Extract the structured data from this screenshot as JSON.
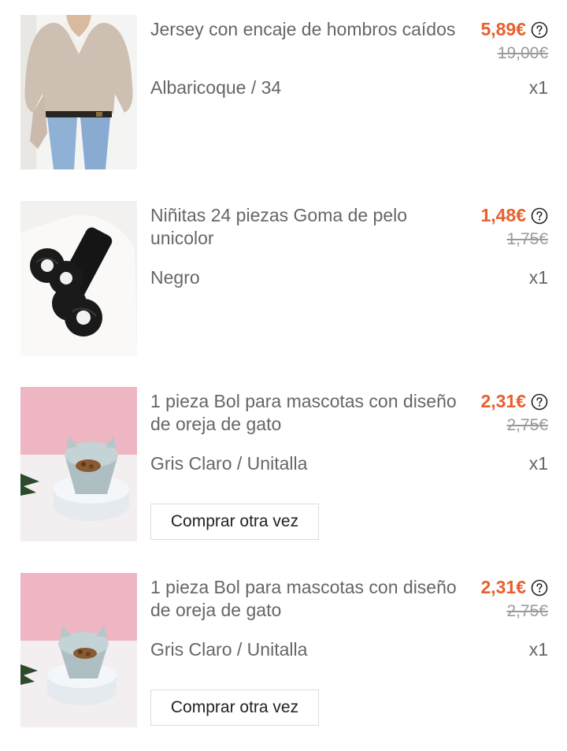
{
  "items": [
    {
      "title": "Jersey con encaje de hombros caídos",
      "price": "5,89€",
      "original_price": "19,00€",
      "variant": "Albaricoque / 34",
      "quantity": "x1",
      "price_help_icon": "question-circle-icon",
      "image": "beige-lace-sweater-jeans"
    },
    {
      "title": "Niñitas 24 piezas Goma de pelo unicolor",
      "price": "1,48€",
      "original_price": "1,75€",
      "variant": "Negro",
      "quantity": "x1",
      "price_help_icon": "question-circle-icon",
      "image": "black-scrunchies"
    },
    {
      "title": "1 pieza Bol para mascotas con diseño de oreja de gato",
      "price": "2,31€",
      "original_price": "2,75€",
      "variant": "Gris Claro / Unitalla",
      "quantity": "x1",
      "price_help_icon": "question-circle-icon",
      "image": "gray-cat-ear-pet-bowl",
      "action_label": "Comprar otra vez"
    },
    {
      "title": "1 pieza Bol para mascotas con diseño de oreja de gato",
      "price": "2,31€",
      "original_price": "2,75€",
      "variant": "Gris Claro / Unitalla",
      "quantity": "x1",
      "price_help_icon": "question-circle-icon",
      "image": "gray-cat-ear-pet-bowl",
      "action_label": "Comprar otra vez"
    }
  ],
  "colors": {
    "price": "#e8602c",
    "text": "#666666",
    "strike": "#9a9a9a"
  }
}
